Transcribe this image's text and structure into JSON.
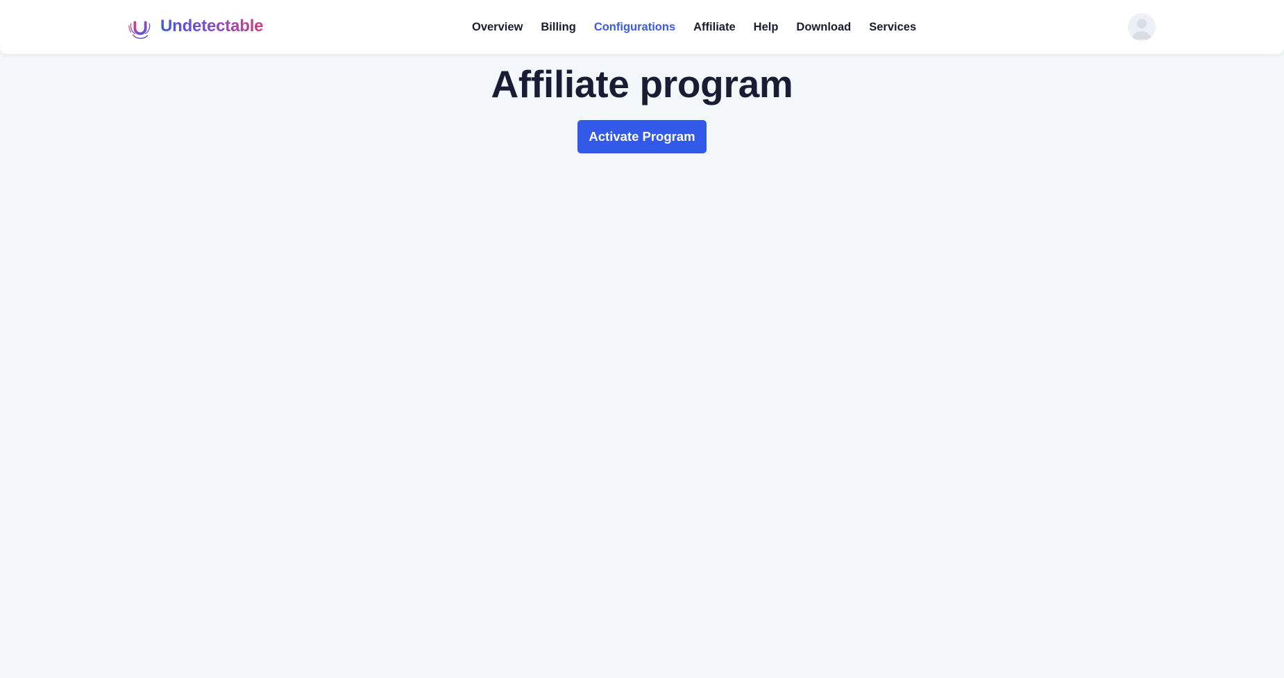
{
  "brand": {
    "name": "Undetectable",
    "icon": "fingerprint-u-logo-icon",
    "gradient": [
      "#3f5bdc",
      "#8a4bc0",
      "#d13e7b"
    ]
  },
  "nav": {
    "items": [
      {
        "label": "Overview",
        "active": false
      },
      {
        "label": "Billing",
        "active": false
      },
      {
        "label": "Configurations",
        "active": true
      },
      {
        "label": "Affiliate",
        "active": false
      },
      {
        "label": "Help",
        "active": false
      },
      {
        "label": "Download",
        "active": false
      },
      {
        "label": "Services",
        "active": false
      }
    ],
    "active_color": "#3a5be8"
  },
  "user": {
    "avatar_icon": "user-avatar-icon"
  },
  "main": {
    "title": "Affiliate program",
    "activate_button_label": "Activate Program",
    "button_color": "#3359e8"
  }
}
